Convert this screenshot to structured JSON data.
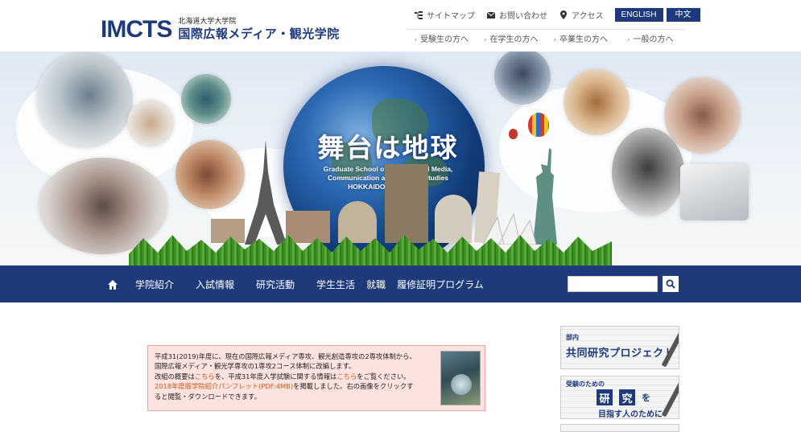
{
  "header": {
    "logo_mark": "IMCTS",
    "logo_sub": "北海道大学大学院",
    "logo_main": "国際広報メディア・観光学院",
    "util_links": [
      {
        "label": "サイトマップ",
        "icon": "sitemap-icon"
      },
      {
        "label": "お問い合わせ",
        "icon": "mail-icon"
      },
      {
        "label": "アクセス",
        "icon": "location-pin-icon"
      }
    ],
    "lang_en": "ENGLISH",
    "lang_zh": "中文",
    "target_links": [
      "受験生の方へ",
      "在学生の方へ",
      "卒業生の方へ",
      "一般の方へ"
    ]
  },
  "hero": {
    "title": "舞台は地球",
    "subtitle_line1": "Graduate School of International Media,",
    "subtitle_line2": "Communication and Tourism Studies",
    "subtitle_line3": "HOKKAIDO UNIVERSITY"
  },
  "nav": {
    "items": [
      "学院紹介",
      "入試情報",
      "研究活動",
      "学生生活",
      "就職",
      "履修証明プログラム"
    ],
    "search_placeholder": "",
    "search_value": ""
  },
  "notice": {
    "line1": "平成31(2019)年度に、現在の国際広報メディア専攻、観光創造専攻の2専攻体制から、",
    "line2": "国際広報メディア・観光学専攻の1専攻2コース体制に改編します。",
    "line3_a": "改組の概要は",
    "line3_link1": "こちら",
    "line3_b": "を、平成31年度入学試験に関する情報は",
    "line3_link2": "こちら",
    "line3_c": "をご覧ください。",
    "line4": "2018年度版学院紹介パンフレット(PDF:4MB)",
    "line4_b": "を掲載しました。右の画像をクリックす",
    "line5": "ると閲覧・ダウンロードできます。"
  },
  "side": {
    "banner1_small": "部内",
    "banner1_main": "共同研究プロジェクト",
    "banner2_small": "受験のための",
    "banner2_box1": "研",
    "banner2_box2": "究",
    "banner2_wo": "を",
    "banner2_bottom": "目指す人のために"
  },
  "colors": {
    "brand_navy": "#1f3a7a",
    "notice_bg": "#fde3df",
    "notice_link": "#d6571e"
  }
}
